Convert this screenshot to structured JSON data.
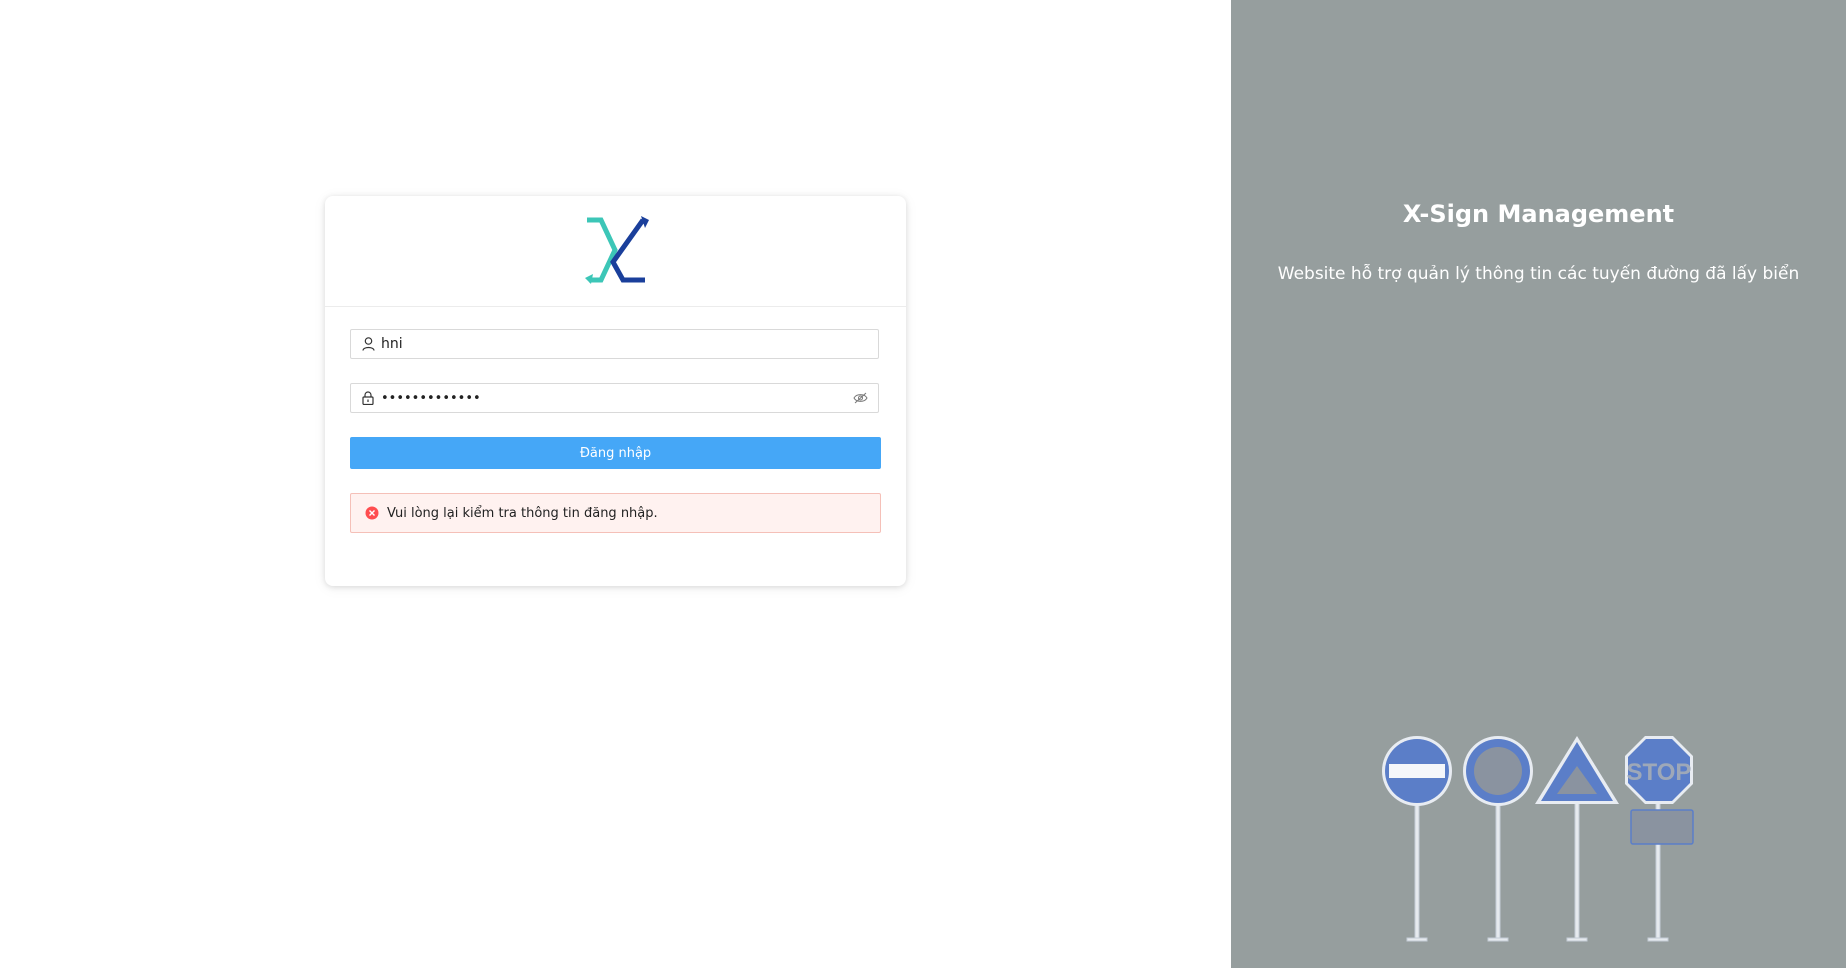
{
  "login": {
    "username_value": "hni",
    "password_value": "•••••••••••••",
    "submit_label": "Đăng nhập",
    "error_message": "Vui lòng lại kiểm tra thông tin đăng nhập."
  },
  "brand": {
    "title": "X-Sign Management",
    "subtitle": "Website hỗ trợ quản lý thông tin các tuyến đường đã lấy biển",
    "stop_sign_text": "STOP"
  },
  "icons": {
    "logo": "x-logo-icon",
    "user": "user-icon",
    "lock": "lock-icon",
    "eye": "eye-invisible-icon",
    "error": "close-circle-icon"
  },
  "colors": {
    "primary_button": "#45a7f7",
    "right_panel_bg": "#969e9e",
    "alert_bg": "#fff2f0",
    "alert_border": "#f5c0b8",
    "error_icon": "#ff4d4f",
    "logo_teal": "#3cc6b7",
    "logo_navy": "#1a3f9b",
    "sign_blue": "#5b7ec8"
  }
}
